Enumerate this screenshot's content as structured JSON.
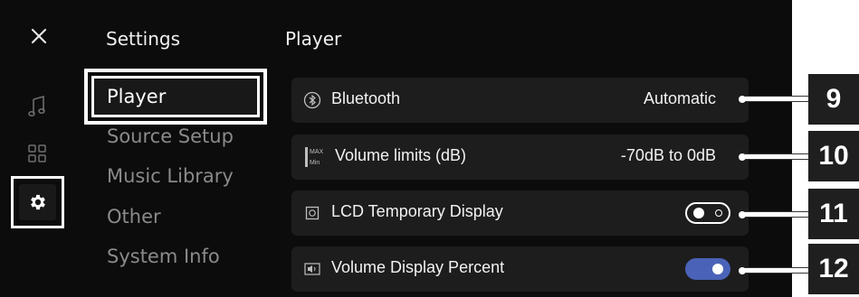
{
  "header": {
    "settings_title": "Settings",
    "page_title": "Player"
  },
  "sidebar": {
    "icons": [
      "music-note-icon",
      "grid-icon",
      "gear-icon"
    ],
    "active": "gear-icon"
  },
  "menu": {
    "items": [
      {
        "label": "Player",
        "active": true
      },
      {
        "label": "Source Setup",
        "active": false
      },
      {
        "label": "Music Library",
        "active": false
      },
      {
        "label": "Other",
        "active": false
      },
      {
        "label": "System Info",
        "active": false
      }
    ]
  },
  "settings": [
    {
      "icon": "bluetooth-icon",
      "label": "Bluetooth",
      "value": "Automatic"
    },
    {
      "icon": "volume-limits-icon",
      "icon_text_top": "MAX",
      "icon_text_bottom": "Min",
      "label": "Volume limits (dB)",
      "value": "-70dB to 0dB"
    },
    {
      "icon": "lcd-display-icon",
      "label": "LCD Temporary Display",
      "toggle": "off"
    },
    {
      "icon": "volume-percent-icon",
      "label": "Volume Display Percent",
      "toggle": "on"
    }
  ],
  "callouts": [
    "9",
    "10",
    "11",
    "12"
  ],
  "colors": {
    "background": "#0c0c0c",
    "row": "#1d1d1d",
    "toggle_on": "#4a63b8"
  }
}
